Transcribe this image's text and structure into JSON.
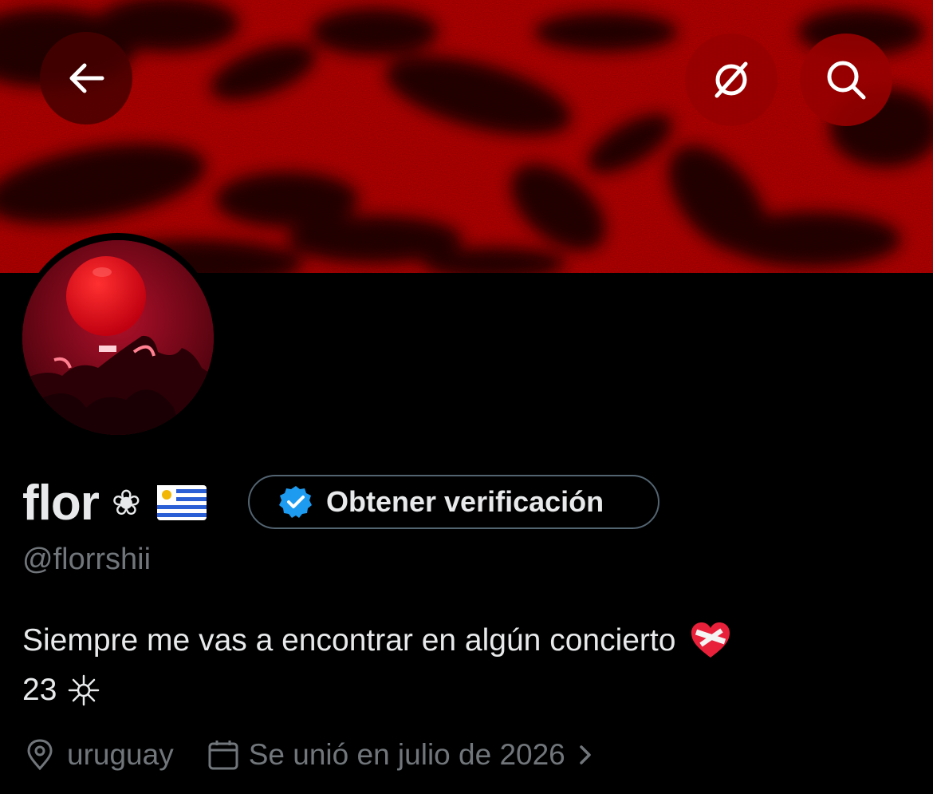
{
  "header": {
    "back_icon": "arrow-left-icon",
    "mute_icon": "muted-circle-icon",
    "search_icon": "search-icon",
    "button_color": "#8b0000"
  },
  "profile": {
    "display_name": "flor",
    "name_glyph": "❀",
    "flag_icon": "uruguay-flag-icon",
    "handle": "@florrshii",
    "verify_button_label": "Obtener verificación",
    "verify_icon": "verified-badge-icon",
    "verify_color": "#1d9bf0",
    "bio_line1": "Siempre me vas a encontrar en algún concierto",
    "bio_emoji_1": "mending-heart-icon",
    "bio_line2": "23",
    "bio_emoji_2": "star-glyph-icon",
    "location": "uruguay",
    "location_icon": "location-pin-icon",
    "joined": "Se unió en julio de 2026",
    "joined_icon": "calendar-icon"
  },
  "colors": {
    "banner": "#c00000",
    "background": "#000000",
    "text_primary": "#e7e9ea",
    "text_secondary": "#71767b",
    "border": "#536471"
  }
}
